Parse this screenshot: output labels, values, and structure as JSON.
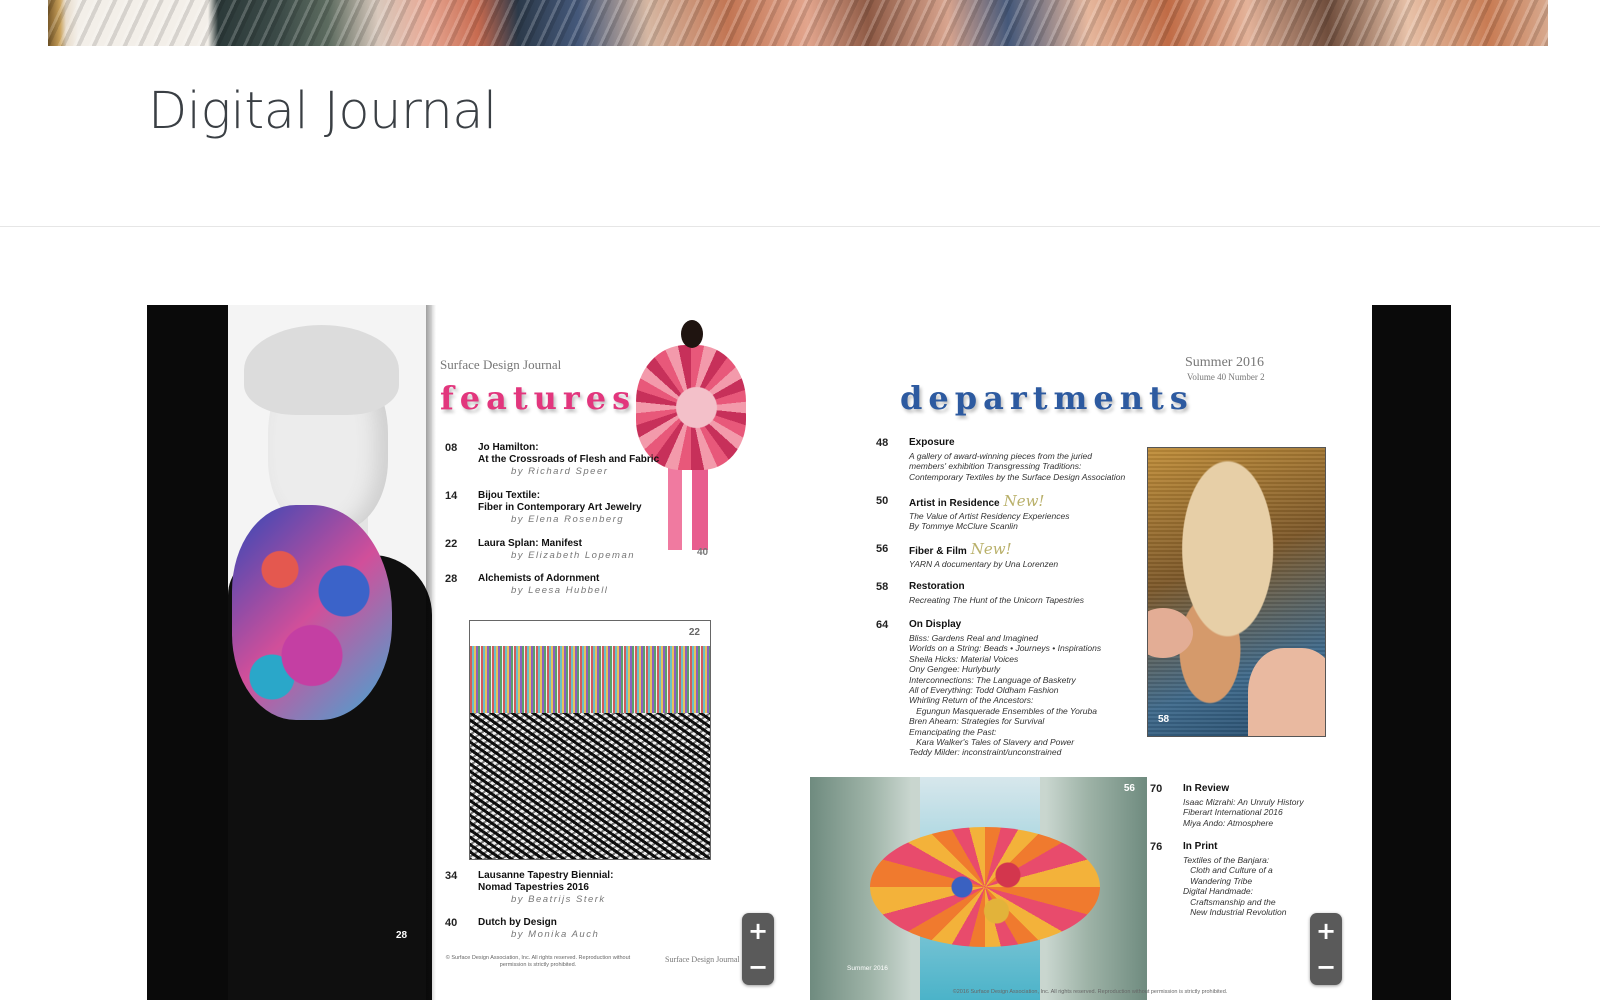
{
  "header": {
    "title": "Digital Journal"
  },
  "viewer": {
    "left_page": {
      "masthead": "Surface Design Journal",
      "section_title": "features",
      "entries": [
        {
          "num": "08",
          "title": "Jo Hamilton:\nAt the Crossroads of Flesh and Fabric",
          "author": "by Richard Speer"
        },
        {
          "num": "14",
          "title": "Bijou Textile:\nFiber in Contemporary Art Jewelry",
          "author": "by Elena Rosenberg"
        },
        {
          "num": "22",
          "title": "Laura Splan: Manifest",
          "author": "by Elizabeth Lopeman"
        },
        {
          "num": "28",
          "title": "Alchemists of Adornment",
          "author": "by Leesa Hubbell"
        },
        {
          "num": "34",
          "title": "Lausanne Tapestry Biennial:\nNomad Tapestries 2016",
          "author": "by Beatrijs Sterk"
        },
        {
          "num": "40",
          "title": "Dutch by Design",
          "author": "by Monika Auch"
        }
      ],
      "image_page_numbers": {
        "dancer": "40",
        "fringe": "22",
        "portrait": "28"
      },
      "footnote": "© Surface Design Association, Inc. All rights reserved. Reproduction without\npermission is strictly prohibited.",
      "footer_masthead": "Surface Design Journal"
    },
    "right_page": {
      "issue": "Summer 2016",
      "volume": "Volume 40 Number 2",
      "section_title": "departments",
      "entries": [
        {
          "num": "48",
          "title": "Exposure",
          "new": "",
          "desc": "A gallery of award-winning pieces from the juried\nmembers' exhibition Transgressing Traditions:\nContemporary Textiles by the Surface Design Association"
        },
        {
          "num": "50",
          "title": "Artist in Residence",
          "new": "New!",
          "desc": "The Value of Artist Residency Experiences\nBy Tommye McClure Scanlin"
        },
        {
          "num": "56",
          "title": "Fiber & Film",
          "new": "New!",
          "desc": "YARN A documentary by Una Lorenzen"
        },
        {
          "num": "58",
          "title": "Restoration",
          "new": "",
          "desc": "Recreating The Hunt of the Unicorn Tapestries"
        },
        {
          "num": "64",
          "title": "On Display",
          "new": "",
          "desc": "Bliss: Gardens Real and Imagined\nWorlds on a String: Beads • Journeys • Inspirations\nSheila Hicks: Material Voices\nOny Gengee: Hurlyburly\nInterconnections: The Language of Basketry\nAll of Everything: Todd Oldham Fashion\nWhirling Return of the Ancestors:\n   Egungun Masquerade Ensembles of the Yoruba\nBren Ahearn: Strategies for Survival\nEmancipating the Past:\n   Kara Walker's Tales of Slavery and Power\nTeddy Milder: inconstraint/unconstrained"
        },
        {
          "num": "70",
          "title": "In Review",
          "new": "",
          "desc": "Isaac Mizrahi: An Unruly History\nFiberart International 2016\nMiya Ando: Atmosphere"
        },
        {
          "num": "76",
          "title": "In Print",
          "new": "",
          "desc": "Textiles of the Banjara:\n   Cloth and Culture of a\n   Wandering Tribe\nDigital Handmade:\n   Craftsmanship and the\n   New Industrial Revolution"
        }
      ],
      "image_page_numbers": {
        "tapestry": "58",
        "installation": "56"
      },
      "installation_caption": "Summer 2016",
      "footnote": "©2016 Surface Design Association, Inc. All rights reserved. Reproduction without permission is strictly prohibited."
    },
    "zoom": {
      "in_label": "+",
      "out_label": "−"
    }
  },
  "colors": {
    "features_accent": "#e2367d",
    "departments_accent": "#2d5aa0",
    "new_badge": "#b9b06a",
    "viewer_background": "#0a0a0a"
  }
}
